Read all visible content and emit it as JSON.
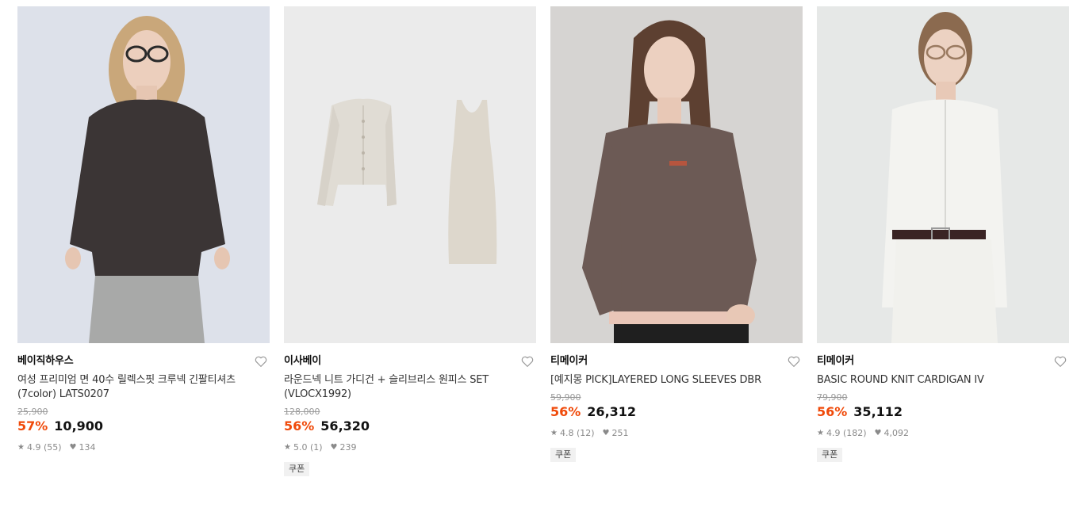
{
  "products": [
    {
      "brand": "베이직하우스",
      "title": "여성 프리미엄 면 40수 릴렉스핏 크루넥 긴팔티셔츠 (7color) LATS0207",
      "original_price": "25,900",
      "discount": "57%",
      "price": "10,900",
      "rating": "4.9 (55)",
      "likes": "134",
      "coupon": ""
    },
    {
      "brand": "이사베이",
      "title": "라운드넥 니트 가디건 + 슬리브리스 원피스 SET (VLOCX1992)",
      "original_price": "128,000",
      "discount": "56%",
      "price": "56,320",
      "rating": "5.0 (1)",
      "likes": "239",
      "coupon": "쿠폰"
    },
    {
      "brand": "티메이커",
      "title": "[예지몽 PICK]LAYERED LONG SLEEVES DBR",
      "original_price": "59,900",
      "discount": "56%",
      "price": "26,312",
      "rating": "4.8 (12)",
      "likes": "251",
      "coupon": "쿠폰"
    },
    {
      "brand": "티메이커",
      "title": "BASIC ROUND KNIT CARDIGAN IV",
      "original_price": "79,900",
      "discount": "56%",
      "price": "35,112",
      "rating": "4.9 (182)",
      "likes": "4,092",
      "coupon": "쿠폰"
    }
  ],
  "icons": {
    "heart": "heart-outline-icon",
    "star": "star-icon",
    "like": "heart-filled-icon"
  },
  "colors": {
    "discount": "#f04a0a",
    "strike": "#9a9a9a",
    "meta": "#8a8a8a"
  }
}
